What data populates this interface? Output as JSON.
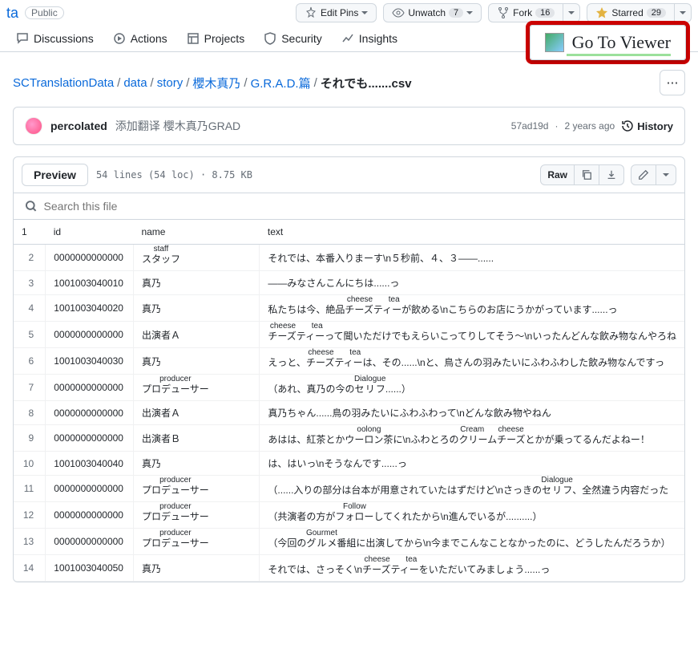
{
  "repo": {
    "name_suffix": "ta",
    "visibility": "Public"
  },
  "top_actions": {
    "edit_pins": "Edit Pins",
    "unwatch": "Unwatch",
    "unwatch_count": "7",
    "fork": "Fork",
    "fork_count": "16",
    "starred": "Starred",
    "starred_count": "29"
  },
  "tabs": {
    "discussions": "Discussions",
    "actions": "Actions",
    "projects": "Projects",
    "security": "Security",
    "insights": "Insights"
  },
  "viewer_button": "Go To Viewer",
  "breadcrumb": {
    "root": "SCTranslationData",
    "parts": [
      "data",
      "story",
      "櫻木真乃",
      "G.R.A.D.篇"
    ],
    "current": "それでも.......csv"
  },
  "commit": {
    "author": "percolated",
    "message": "添加翻译 櫻木真乃GRAD",
    "sha": "57ad19d",
    "age": "2 years ago",
    "history": "History"
  },
  "file_header": {
    "preview": "Preview",
    "meta": "54 lines (54 loc) · 8.75 KB",
    "raw": "Raw"
  },
  "search_placeholder": "Search this file",
  "columns": {
    "id": "id",
    "name": "name",
    "text": "text"
  },
  "rows": [
    {
      "ln": "2",
      "id": "0000000000000",
      "name_ruby": "staff",
      "name": "スタッフ",
      "text": "それでは、本番入りまーす\\n５秒前、４、３――......"
    },
    {
      "ln": "3",
      "id": "1001003040010",
      "name": "真乃",
      "text": "――みなさんこんにちは......っ"
    },
    {
      "ln": "4",
      "id": "1001003040020",
      "name": "真乃",
      "text_pre": "私たちは今、絶品",
      "ruby_rt": "cheese　tea",
      "ruby_rb": "チーズティー",
      "text_post": "が飲める\\nこちらのお店にうかがっています......っ"
    },
    {
      "ln": "5",
      "id": "0000000000000",
      "name": "出演者Ａ",
      "ruby_rt": "cheese　tea",
      "ruby_rb": "チーズティー",
      "text_post": "って聞いただけでもえらいこってりしてそう～\\nいったんどんな飲み物なんやろね"
    },
    {
      "ln": "6",
      "id": "1001003040030",
      "name": "真乃",
      "text_pre": "えっと、",
      "ruby_rt": "cheese　tea",
      "ruby_rb": "チーズティー",
      "text_post": "は、その......\\nと、鳥さんの羽みたいにふわふわした飲み物なんですっ"
    },
    {
      "ln": "7",
      "id": "0000000000000",
      "name_ruby": "producer",
      "name": "プロデューサー",
      "text_pre": "（あれ、真乃の今の",
      "ruby_rt": "Dialogue",
      "ruby_rb": "セリフ",
      "text_post": "......）"
    },
    {
      "ln": "8",
      "id": "0000000000000",
      "name": "出演者Ａ",
      "text": "真乃ちゃん......鳥の羽みたいにふわふわって\\nどんな飲み物やねん"
    },
    {
      "ln": "9",
      "id": "0000000000000",
      "name": "出演者Ｂ",
      "text_pre": "あはは、紅茶とか",
      "ruby_rt": "oolong",
      "ruby_rb": "ウーロン茶",
      "text_mid": "に\\nふわとろの",
      "ruby2_rt": "Cream　cheese",
      "ruby2_rb": "クリームチーズ",
      "text_post": "とかが乗ってるんだよねー！"
    },
    {
      "ln": "10",
      "id": "1001003040040",
      "name": "真乃",
      "text": "は、はいっ\\nそうなんです......っ"
    },
    {
      "ln": "11",
      "id": "0000000000000",
      "name_ruby": "producer",
      "name": "プロデューサー",
      "text_pre": "（......入りの部分は台本が用意されていたはずだけど\\nさっきの",
      "ruby_rt": "Dialogue",
      "ruby_rb": "セリフ",
      "text_post": "、全然違う内容だった"
    },
    {
      "ln": "12",
      "id": "0000000000000",
      "name_ruby": "producer",
      "name": "プロデューサー",
      "text_pre": "（共演者の方が",
      "ruby_rt": "Follow",
      "ruby_rb": "フォロー",
      "text_post": "してくれたから\\n進んでいるが..........）"
    },
    {
      "ln": "13",
      "id": "0000000000000",
      "name_ruby": "producer",
      "name": "プロデューサー",
      "text_pre": "（今回の",
      "ruby_rt": "Gourmet",
      "ruby_rb": "グルメ",
      "text_post": "番組に出演してから\\n今までこんなことなかったのに、どうしたんだろうか）"
    },
    {
      "ln": "14",
      "id": "1001003040050",
      "name": "真乃",
      "text_pre": "それでは、さっそく\\n",
      "ruby_rt": "cheese　tea",
      "ruby_rb": "チーズティー",
      "text_post": "をいただいてみましょう......っ"
    }
  ]
}
